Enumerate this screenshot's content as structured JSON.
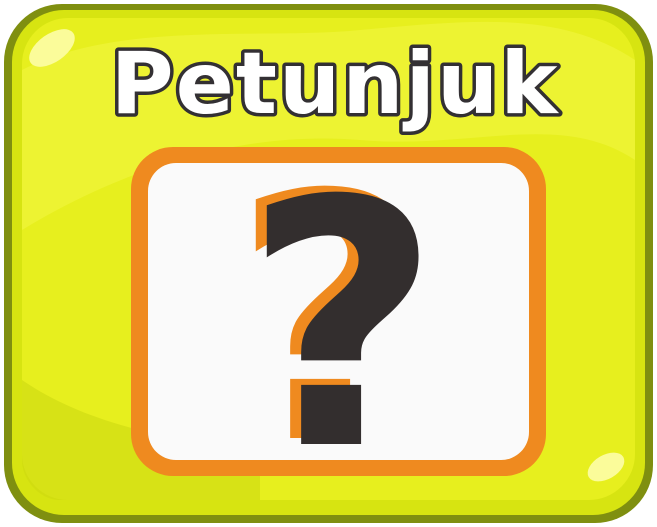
{
  "card": {
    "title": "Petunjuk",
    "symbol": "?"
  },
  "colors": {
    "frame_outer": "#7f8f10",
    "frame_main": "#d7e411",
    "frame_highlight": "#f2f63a",
    "title_fill": "#ffffff",
    "title_outline": "#333033",
    "box_border": "#ef8a1f",
    "box_fill": "#fafafa",
    "symbol_fill": "#332e2e",
    "symbol_shadow": "#ef8a1f"
  }
}
